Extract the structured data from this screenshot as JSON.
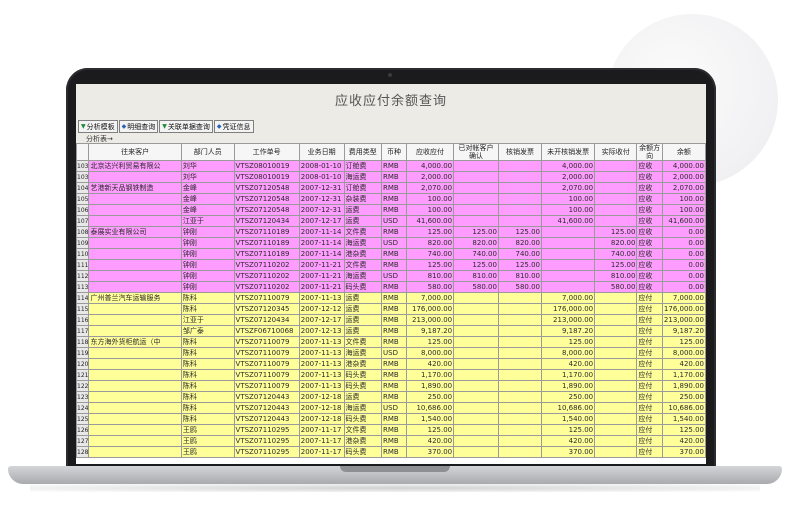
{
  "window": {
    "title": "应收应付余额查询"
  },
  "toolbar": [
    {
      "label": "分析模板",
      "icon": "arrow-down-icon"
    },
    {
      "label": "明细查询",
      "icon": "detail-query-icon"
    },
    {
      "label": "关联单据查询",
      "icon": "arrow-down-icon"
    },
    {
      "label": "凭证信息",
      "icon": "voucher-icon"
    }
  ],
  "analysis_link": "分析表→",
  "colors": {
    "pink": "#ff9cff",
    "yellow": "#ffff99",
    "white": "#ffffff"
  },
  "table": {
    "headers": [
      "",
      "往来客户",
      "部门人员",
      "工作单号",
      "业务日期",
      "费用类型",
      "币种",
      "应收应付",
      "已对帐客户确认",
      "核销发票",
      "未开核销发票",
      "实际收付",
      "余额方向",
      "余额"
    ],
    "rows": [
      {
        "color": "pink",
        "cells": [
          "103",
          "北京达兴利贸易有限公",
          "刘华",
          "VTSZ08010019",
          "2008-01-10",
          "订舱费",
          "RMB",
          "4,000.00",
          "",
          "",
          "4,000.00",
          "",
          "应收",
          "4,000.00"
        ]
      },
      {
        "color": "pink",
        "cells": [
          "103",
          "",
          "刘华",
          "VTSZ08010019",
          "2008-01-10",
          "海运费",
          "RMB",
          "2,000.00",
          "",
          "",
          "2,000.00",
          "",
          "应收",
          "2,000.00"
        ]
      },
      {
        "color": "pink",
        "cells": [
          "104",
          "艺港新天品钢铁制造",
          "金峰",
          "VTSZ07120548",
          "2007-12-31",
          "订舱费",
          "RMB",
          "2,070.00",
          "",
          "",
          "2,070.00",
          "",
          "应收",
          "2,070.00"
        ]
      },
      {
        "color": "pink",
        "cells": [
          "105",
          "",
          "金峰",
          "VTSZ07120548",
          "2007-12-31",
          "杂装费",
          "RMB",
          "100.00",
          "",
          "",
          "100.00",
          "",
          "应收",
          "100.00"
        ]
      },
      {
        "color": "pink",
        "cells": [
          "106",
          "",
          "金峰",
          "VTSZ07120548",
          "2007-12-31",
          "运费",
          "RMB",
          "100.00",
          "",
          "",
          "100.00",
          "",
          "应收",
          "100.00"
        ]
      },
      {
        "color": "pink",
        "cells": [
          "107",
          "",
          "江亚于",
          "VTSZ07120434",
          "2007-12-17",
          "运费",
          "USD",
          "41,600.00",
          "",
          "",
          "41,600.00",
          "",
          "应收",
          "41,600.00"
        ]
      },
      {
        "color": "pink",
        "cells": [
          "108",
          "泰展实业有限公司",
          "钟刚",
          "VTSZ07110189",
          "2007-11-14",
          "文件费",
          "RMB",
          "125.00",
          "125.00",
          "125.00",
          "",
          "125.00",
          "应收",
          "0.00"
        ]
      },
      {
        "color": "pink",
        "cells": [
          "109",
          "",
          "钟刚",
          "VTSZ07110189",
          "2007-11-14",
          "海运费",
          "USD",
          "820.00",
          "820.00",
          "820.00",
          "",
          "820.00",
          "应收",
          "0.00"
        ]
      },
      {
        "color": "pink",
        "cells": [
          "110",
          "",
          "钟刚",
          "VTSZ07110189",
          "2007-11-14",
          "港杂费",
          "RMB",
          "740.00",
          "740.00",
          "740.00",
          "",
          "740.00",
          "应收",
          "0.00"
        ]
      },
      {
        "color": "pink",
        "cells": [
          "111",
          "",
          "钟刚",
          "VTSZ07110202",
          "2007-11-21",
          "文件费",
          "RMB",
          "125.00",
          "125.00",
          "125.00",
          "",
          "125.00",
          "应收",
          "0.00"
        ]
      },
      {
        "color": "pink",
        "cells": [
          "112",
          "",
          "钟刚",
          "VTSZ07110202",
          "2007-11-21",
          "海运费",
          "USD",
          "810.00",
          "810.00",
          "810.00",
          "",
          "810.00",
          "应收",
          "0.00"
        ]
      },
      {
        "color": "pink",
        "cells": [
          "113",
          "",
          "钟刚",
          "VTSZ07110202",
          "2007-11-21",
          "码头费",
          "RMB",
          "580.00",
          "580.00",
          "580.00",
          "",
          "580.00",
          "应收",
          "0.00"
        ]
      },
      {
        "color": "yellow",
        "cells": [
          "114",
          "广州普兰汽车运输服务",
          "陈科",
          "VTSZ07110079",
          "2007-11-13",
          "运费",
          "RMB",
          "7,000.00",
          "",
          "",
          "7,000.00",
          "",
          "应付",
          "7,000.00"
        ]
      },
      {
        "color": "yellow",
        "cells": [
          "115",
          "",
          "陈科",
          "VTSZ07120345",
          "2007-12-12",
          "运费",
          "RMB",
          "176,000.00",
          "",
          "",
          "176,000.00",
          "",
          "应付",
          "176,000.00"
        ]
      },
      {
        "color": "yellow",
        "cells": [
          "116",
          "",
          "江亚于",
          "VTSZ07120434",
          "2007-12-17",
          "运费",
          "RMB",
          "213,000.00",
          "",
          "",
          "213,000.00",
          "",
          "应付",
          "213,000.00"
        ]
      },
      {
        "color": "yellow",
        "cells": [
          "117",
          "",
          "邹广泰",
          "VTSZF06710068",
          "2007-12-13",
          "运费",
          "RMB",
          "9,187.20",
          "",
          "",
          "9,187.20",
          "",
          "应付",
          "9,187.20"
        ]
      },
      {
        "color": "yellow",
        "cells": [
          "118",
          "东方海外货柜航运（中",
          "陈科",
          "VTSZ07110079",
          "2007-11-13",
          "文件费",
          "RMB",
          "125.00",
          "",
          "",
          "125.00",
          "",
          "应付",
          "125.00"
        ]
      },
      {
        "color": "yellow",
        "cells": [
          "119",
          "",
          "陈科",
          "VTSZ07110079",
          "2007-11-13",
          "海运费",
          "USD",
          "8,000.00",
          "",
          "",
          "8,000.00",
          "",
          "应付",
          "8,000.00"
        ]
      },
      {
        "color": "yellow",
        "cells": [
          "120",
          "",
          "陈科",
          "VTSZ07110079",
          "2007-11-13",
          "港杂费",
          "RMB",
          "420.00",
          "",
          "",
          "420.00",
          "",
          "应付",
          "420.00"
        ]
      },
      {
        "color": "yellow",
        "cells": [
          "121",
          "",
          "陈科",
          "VTSZ07110079",
          "2007-11-13",
          "码头费",
          "RMB",
          "1,170.00",
          "",
          "",
          "1,170.00",
          "",
          "应付",
          "1,170.00"
        ]
      },
      {
        "color": "yellow",
        "cells": [
          "122",
          "",
          "陈科",
          "VTSZ07110079",
          "2007-11-13",
          "码头费",
          "RMB",
          "1,890.00",
          "",
          "",
          "1,890.00",
          "",
          "应付",
          "1,890.00"
        ]
      },
      {
        "color": "yellow",
        "cells": [
          "123",
          "",
          "陈科",
          "VTSZ07120443",
          "2007-12-18",
          "运费",
          "RMB",
          "250.00",
          "",
          "",
          "250.00",
          "",
          "应付",
          "250.00"
        ]
      },
      {
        "color": "yellow",
        "cells": [
          "124",
          "",
          "陈科",
          "VTSZ07120443",
          "2007-12-18",
          "海运费",
          "USD",
          "10,686.00",
          "",
          "",
          "10,686.00",
          "",
          "应付",
          "10,686.00"
        ]
      },
      {
        "color": "yellow",
        "cells": [
          "125",
          "",
          "陈科",
          "VTSZ07120443",
          "2007-12-18",
          "码头费",
          "RMB",
          "1,540.00",
          "",
          "",
          "1,540.00",
          "",
          "应付",
          "1,540.00"
        ]
      },
      {
        "color": "yellow",
        "cells": [
          "126",
          "",
          "王鸥",
          "VTSZ07110295",
          "2007-11-17",
          "文件费",
          "RMB",
          "125.00",
          "",
          "",
          "125.00",
          "",
          "应付",
          "125.00"
        ]
      },
      {
        "color": "yellow",
        "cells": [
          "127",
          "",
          "王鸥",
          "VTSZ07110295",
          "2007-11-17",
          "港杂费",
          "RMB",
          "420.00",
          "",
          "",
          "420.00",
          "",
          "应付",
          "420.00"
        ]
      },
      {
        "color": "yellow",
        "cells": [
          "128",
          "",
          "王鸥",
          "VTSZ07110295",
          "2007-11-17",
          "码头费",
          "RMB",
          "370.00",
          "",
          "",
          "370.00",
          "",
          "应付",
          "370.00"
        ]
      }
    ]
  }
}
